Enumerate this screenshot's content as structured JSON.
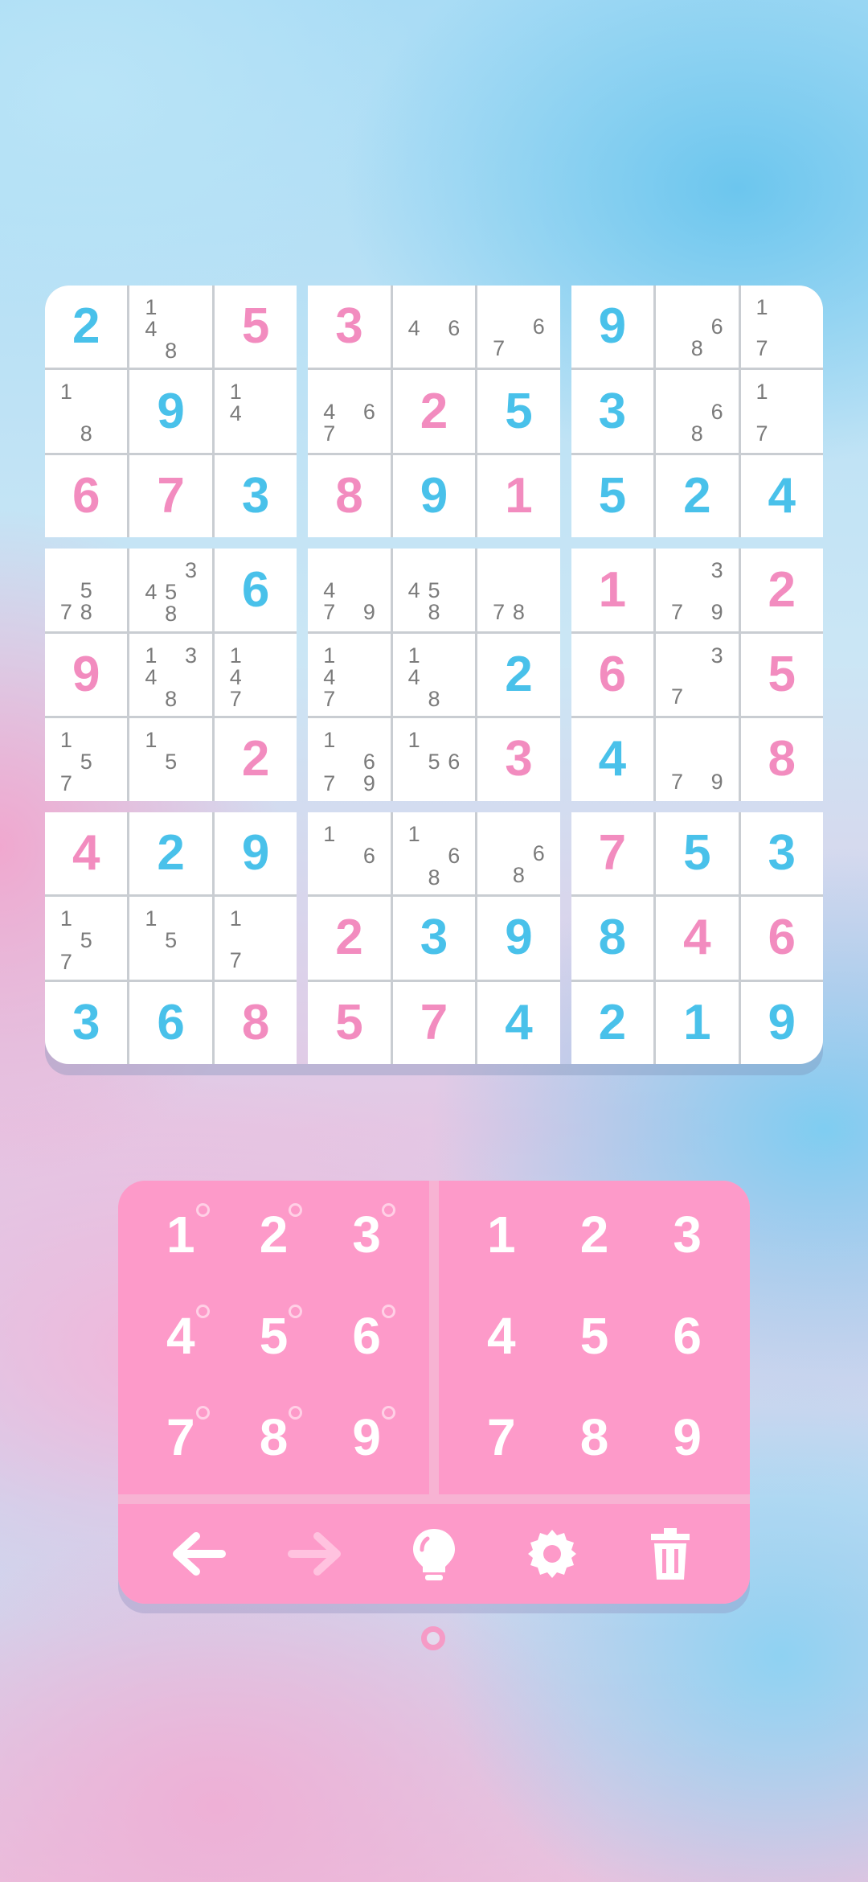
{
  "colors": {
    "blue_digit": "#49c1ea",
    "pink_digit": "#f28cbf",
    "note_digit": "#7b7b7b",
    "keypad": "#fd9ac9"
  },
  "board": {
    "cells": [
      [
        "2|blue",
        "148",
        "5|pink",
        "3|pink",
        "46",
        "67",
        "9|blue",
        "68",
        "17"
      ],
      [
        "18",
        "9|blue",
        "14",
        "467",
        "2|pink",
        "5|blue",
        "3|blue",
        "68",
        "17"
      ],
      [
        "6|pink",
        "7|pink",
        "3|blue",
        "8|pink",
        "9|blue",
        "1|pink",
        "5|blue",
        "2|blue",
        "4|blue"
      ],
      [
        "578",
        "3458",
        "6|blue",
        "479",
        "458",
        "78",
        "1|pink",
        "379",
        "2|pink"
      ],
      [
        "9|pink",
        "1348",
        "147",
        "147",
        "148",
        "2|blue",
        "6|pink",
        "37",
        "5|pink"
      ],
      [
        "157",
        "15",
        "2|pink",
        "1679",
        "156",
        "3|pink",
        "4|blue",
        "79",
        "8|pink"
      ],
      [
        "4|pink",
        "2|blue",
        "9|blue",
        "16",
        "168",
        "68",
        "7|pink",
        "5|blue",
        "3|blue"
      ],
      [
        "157",
        "15",
        "17",
        "2|pink",
        "3|blue",
        "9|blue",
        "8|blue",
        "4|pink",
        "6|pink"
      ],
      [
        "3|blue",
        "6|blue",
        "8|pink",
        "5|pink",
        "7|pink",
        "4|blue",
        "2|blue",
        "1|blue",
        "9|blue"
      ]
    ]
  },
  "keypad": {
    "notes_keys": [
      "1",
      "2",
      "3",
      "4",
      "5",
      "6",
      "7",
      "8",
      "9"
    ],
    "value_keys": [
      "1",
      "2",
      "3",
      "4",
      "5",
      "6",
      "7",
      "8",
      "9"
    ],
    "tools": [
      "undo-icon",
      "redo-icon",
      "hint-bulb-icon",
      "settings-gear-icon",
      "trash-icon"
    ]
  }
}
